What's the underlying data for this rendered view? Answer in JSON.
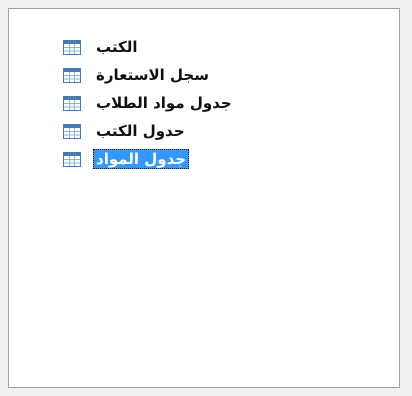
{
  "tree": {
    "items": [
      {
        "label": "الكتب",
        "icon": "table-icon",
        "selected": false
      },
      {
        "label": "سجل الاستعارة",
        "icon": "table-icon",
        "selected": false
      },
      {
        "label": "جدول مواد الطلاب",
        "icon": "table-icon",
        "selected": false
      },
      {
        "label": "حدول الكتب",
        "icon": "table-icon",
        "selected": false
      },
      {
        "label": "جدول المواد",
        "icon": "table-icon",
        "selected": true
      }
    ]
  },
  "colors": {
    "selection_background": "#3399ff",
    "selection_text": "#ffffff",
    "icon_header": "#4a78b5",
    "icon_grid": "#8fb3df"
  }
}
